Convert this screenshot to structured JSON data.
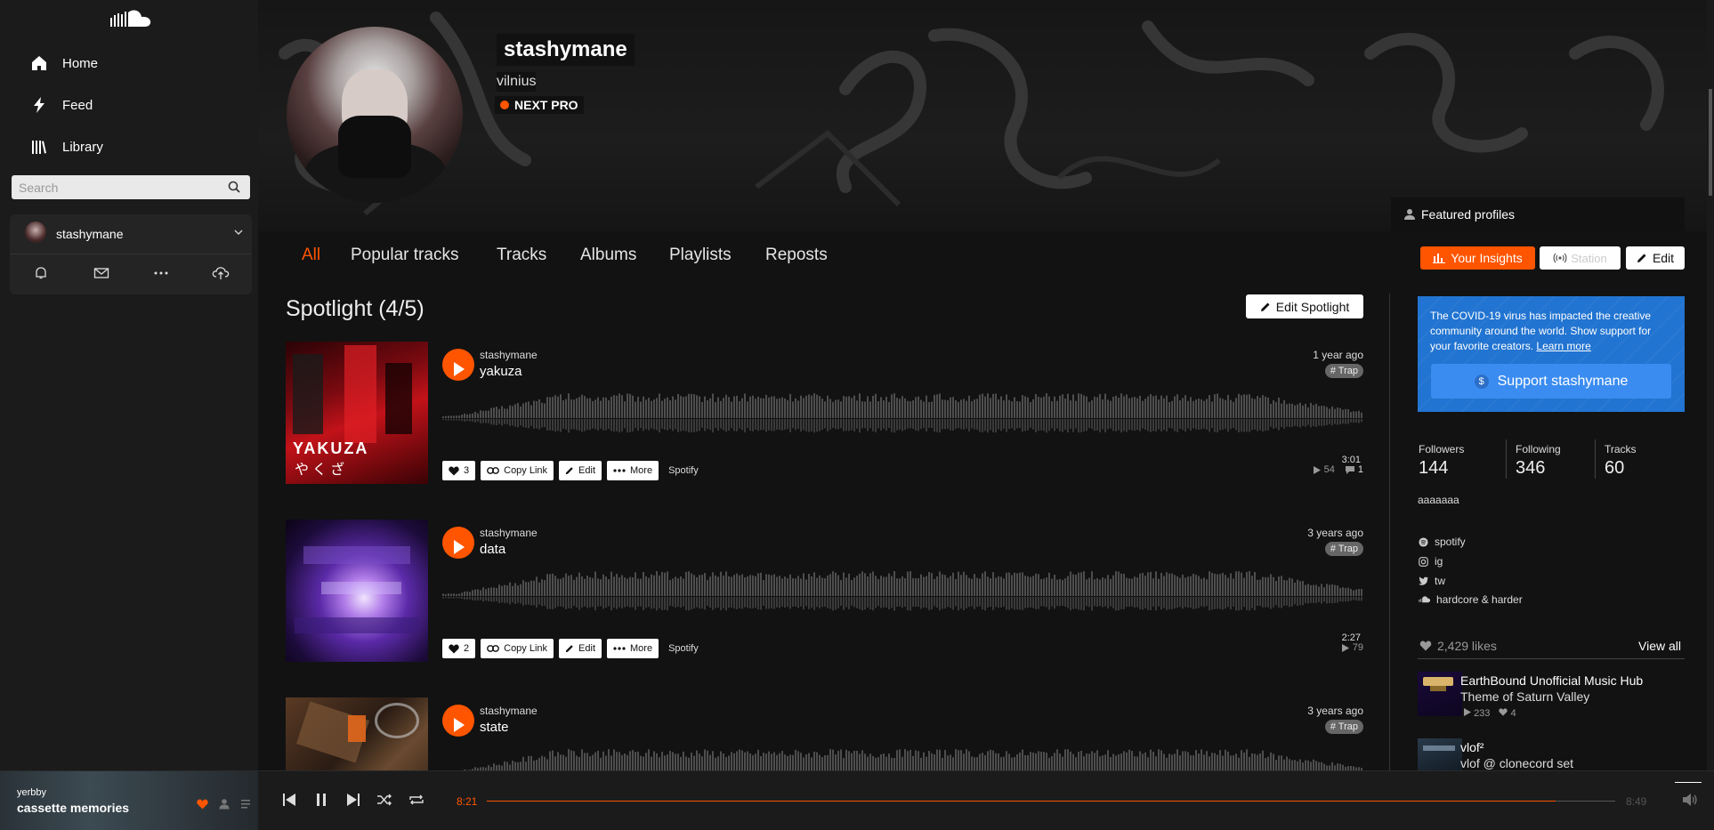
{
  "sidebar": {
    "logo_icon": "soundcloud-logo",
    "nav": [
      {
        "label": "Home",
        "icon": "home-icon"
      },
      {
        "label": "Feed",
        "icon": "lightning-icon"
      },
      {
        "label": "Library",
        "icon": "library-icon"
      }
    ],
    "search_placeholder": "Search",
    "user": {
      "name": "stashymane"
    },
    "user_icons": [
      "bell-icon",
      "mail-icon",
      "more-icon",
      "upload-icon"
    ]
  },
  "profile": {
    "name": "stashymane",
    "city": "vilnius",
    "badge": "NEXT PRO",
    "featured_label": "Featured profiles"
  },
  "tabs": [
    "All",
    "Popular tracks",
    "Tracks",
    "Albums",
    "Playlists",
    "Reposts"
  ],
  "actions": {
    "insights": "Your Insights",
    "station": "Station",
    "edit": "Edit"
  },
  "spotlight": {
    "title": "Spotlight (4/5)",
    "edit_label": "Edit Spotlight",
    "tracks": [
      {
        "user": "stashymane",
        "title": "yakuza",
        "date": "1 year ago",
        "tag": "# Trap",
        "duration": "3:01",
        "likes": "3",
        "plays": "54",
        "comments": "1",
        "art_text": "YAKUZA",
        "art_sub": "やくざ"
      },
      {
        "user": "stashymane",
        "title": "data",
        "date": "3 years ago",
        "tag": "# Trap",
        "duration": "2:27",
        "likes": "2",
        "plays": "79"
      },
      {
        "user": "stashymane",
        "title": "state",
        "date": "3 years ago",
        "tag": "# Trap"
      }
    ],
    "btn": {
      "copy": "Copy Link",
      "edit": "Edit",
      "more": "More",
      "spotify": "Spotify"
    }
  },
  "covid": {
    "text": "The COVID-19 virus has impacted the creative community around the world. Show support for your favorite creators.",
    "link": "Learn more",
    "button": "Support stashymane",
    "dollar": "$"
  },
  "stats": [
    {
      "label": "Followers",
      "value": "144"
    },
    {
      "label": "Following",
      "value": "346"
    },
    {
      "label": "Tracks",
      "value": "60"
    }
  ],
  "bio": "aaaaaaa",
  "links": [
    {
      "label": "spotify",
      "icon": "spotify-icon"
    },
    {
      "label": "ig",
      "icon": "instagram-icon"
    },
    {
      "label": "tw",
      "icon": "twitter-icon"
    },
    {
      "label": "hardcore & harder",
      "icon": "soundcloud-icon"
    }
  ],
  "likes": {
    "count_label": "2,429 likes",
    "view_all": "View all",
    "items": [
      {
        "line1": "EarthBound Unofficial Music Hub",
        "line2": "Theme of Saturn Valley",
        "plays": "233",
        "likes": "4"
      },
      {
        "line1": "vlof²",
        "line2": "vlof @ clonecord set"
      }
    ]
  },
  "player": {
    "user": "yerbby",
    "title": "cassette memories",
    "elapsed": "8:21",
    "total": "8:49",
    "progress": 0.947,
    "accent": "#ff5500"
  }
}
